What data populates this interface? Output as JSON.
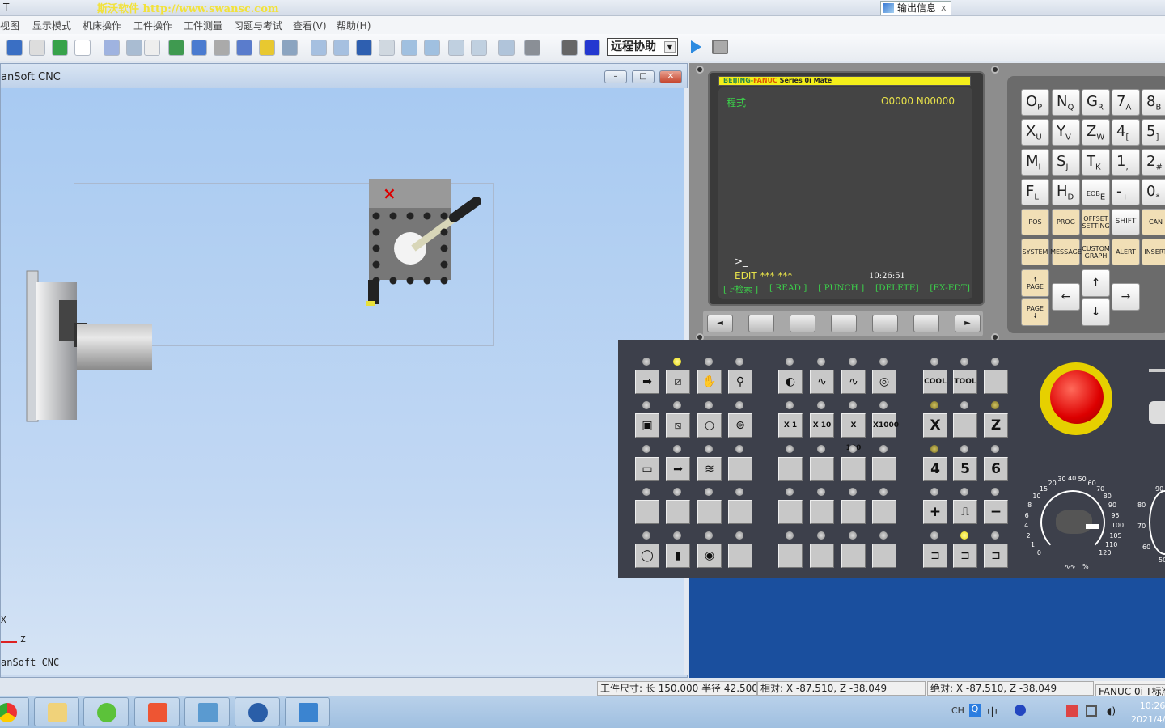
{
  "titlebar": {
    "title": "T",
    "watermark": "斯沃软件 http://www.swansc.com",
    "output_tab": "输出信息",
    "output_tab_close": "x"
  },
  "menu": [
    "视图",
    "显示模式",
    "机床操作",
    "工件操作",
    "工件测量",
    "习题与考试",
    "查看(V)",
    "帮助(H)"
  ],
  "toolbar": {
    "remote_select": "远程协助",
    "icons": [
      "zoom-icon",
      "hand-pan-icon",
      "rotate-icon",
      "select-rect-icon",
      "view-plane-icon",
      "xz-view-icon",
      "download-icon",
      "open-file-icon",
      "ruler-icon",
      "gear-wifi-icon",
      "edit-icon",
      "stars-icon",
      "coolant-icon",
      "blank-icon",
      "blank2-icon",
      "blank3-icon",
      "blank4-icon",
      "tool-holder-icon",
      "tool-number-icon",
      "tool-icon",
      "boring-tool-icon",
      "chuck-icon",
      "camera-icon",
      "film-icon",
      "film-save-icon"
    ]
  },
  "window": {
    "title": "anSoft CNC",
    "minimize": "–",
    "maximize": "□",
    "close": "✕",
    "axis_x": "X",
    "axis_z": "Z",
    "view_label": "anSoft CNC"
  },
  "status": {
    "size": "工件尺寸: 长 150.000 半径  42.500",
    "relative": "相对: X -87.510, Z -38.049",
    "absolute": "绝对: X -87.510, Z -38.049",
    "system": "FANUC 0i-T标准"
  },
  "taskbar": {
    "tray_lang": "CH",
    "tray_ime": "中",
    "time": "10:26",
    "date": "2021/4/"
  },
  "cnc": {
    "brand_left": "BEIJING-",
    "brand_fanuc": "FANUC",
    "brand_series": " Series 0i Mate",
    "mode_title": "程式",
    "program_number": "O0000  N00000",
    "prompt": ">_",
    "status_line": "EDIT *** ***",
    "clock": "10:26:51",
    "softkeys": [
      "[ F检索 ]",
      "[ READ ]",
      "[ PUNCH ]",
      "[DELETE]",
      "[EX-EDT]"
    ],
    "keys": [
      [
        "O",
        "P"
      ],
      [
        "N",
        "Q"
      ],
      [
        "G",
        "R"
      ],
      [
        "7",
        "A"
      ],
      [
        "8",
        "B"
      ],
      [
        "X",
        "U"
      ],
      [
        "Y",
        "V"
      ],
      [
        "Z",
        "W"
      ],
      [
        "4",
        "["
      ],
      [
        "5",
        "]"
      ],
      [
        "M",
        "I"
      ],
      [
        "S",
        "J"
      ],
      [
        "T",
        "K"
      ],
      [
        "1",
        ","
      ],
      [
        "2",
        "#"
      ],
      [
        "F",
        "L"
      ],
      [
        "H",
        "D"
      ],
      [
        "EOB",
        "E"
      ],
      [
        "-",
        "+"
      ],
      [
        "0",
        "*"
      ]
    ],
    "function_keys": [
      "POS",
      "PROG",
      "OFFSET SETTING",
      "SHIFT",
      "CAN",
      "SYSTEM",
      "MESSAGE",
      "CUSTOM GRAPH",
      "ALERT",
      "INSERT"
    ],
    "page_up": "PAGE",
    "page_down": "PAGE",
    "panel_labels": {
      "cool": "COOL",
      "tool": "TOOL",
      "x1": "X 1",
      "x10": "X 10",
      "x100": "X 100",
      "x1000": "X1000",
      "x": "X",
      "z": "Z",
      "4": "4",
      "5": "5",
      "6": "6",
      "plus": "+",
      "minus": "−"
    },
    "feed_dial": {
      "labels": [
        "0",
        "1",
        "2",
        "4",
        "6",
        "8",
        "10",
        "15",
        "20",
        "30",
        "40",
        "50",
        "60",
        "70",
        "80",
        "90",
        "95",
        "100",
        "105",
        "110",
        "120"
      ],
      "unit": "%",
      "value": 100
    },
    "spindle_dial": {
      "labels": [
        "50",
        "60",
        "70",
        "80",
        "90"
      ]
    }
  }
}
